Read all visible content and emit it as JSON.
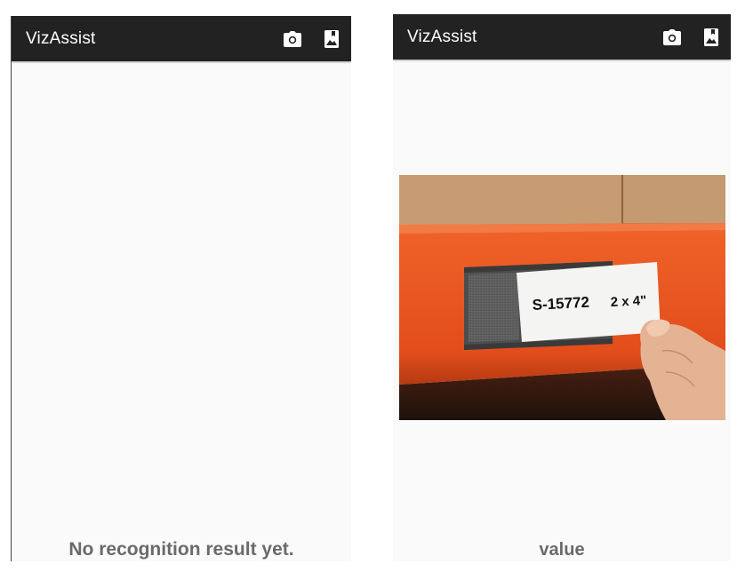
{
  "left_screen": {
    "app_title": "VizAssist",
    "toolbar_icons": [
      "camera-icon",
      "gallery-icon"
    ],
    "result_text": "No recognition result yet."
  },
  "right_screen": {
    "app_title": "VizAssist",
    "toolbar_icons": [
      "camera-icon",
      "gallery-icon"
    ],
    "image": {
      "label_code": "S-15772",
      "label_size": "2 x 4\""
    },
    "result_text": "value"
  },
  "colors": {
    "appbar": "#222222",
    "background": "#fafafa",
    "result_text": "#6a6a6a",
    "shelf_orange": "#e8521f"
  }
}
